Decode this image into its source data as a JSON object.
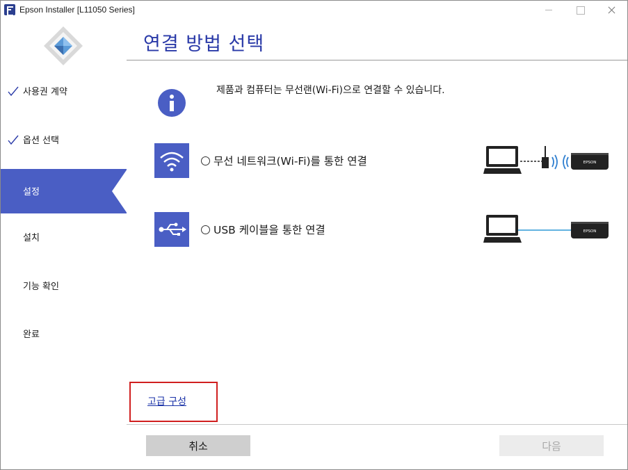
{
  "window": {
    "title": "Epson Installer [L11050 Series]"
  },
  "sidebar": {
    "steps": [
      {
        "label": "사용권 계약",
        "state": "done"
      },
      {
        "label": "옵션 선택",
        "state": "done"
      },
      {
        "label": "설정",
        "state": "active"
      },
      {
        "label": "설치",
        "state": "pending"
      },
      {
        "label": "기능 확인",
        "state": "pending"
      },
      {
        "label": "완료",
        "state": "pending"
      }
    ]
  },
  "main": {
    "title": "연결 방법 선택",
    "info_text": "제품과 컴퓨터는 무선랜(Wi-Fi)으로 연결할 수 있습니다.",
    "options": [
      {
        "label": "무선 네트워크(Wi-Fi)를 통한 연결",
        "icon": "wifi-icon",
        "selected": false
      },
      {
        "label": "USB 케이블을 통한 연결",
        "icon": "usb-icon",
        "selected": false
      }
    ],
    "printer_label": "EPSON",
    "advanced_link": "고급 구성"
  },
  "footer": {
    "cancel_label": "취소",
    "next_label": "다음"
  },
  "colors": {
    "accent": "#4a5ec4",
    "title": "#2a3aa8",
    "highlight_border": "#d01f1f",
    "wireless_wave": "#2f7fd0",
    "usb_cable": "#2f9ad6"
  }
}
